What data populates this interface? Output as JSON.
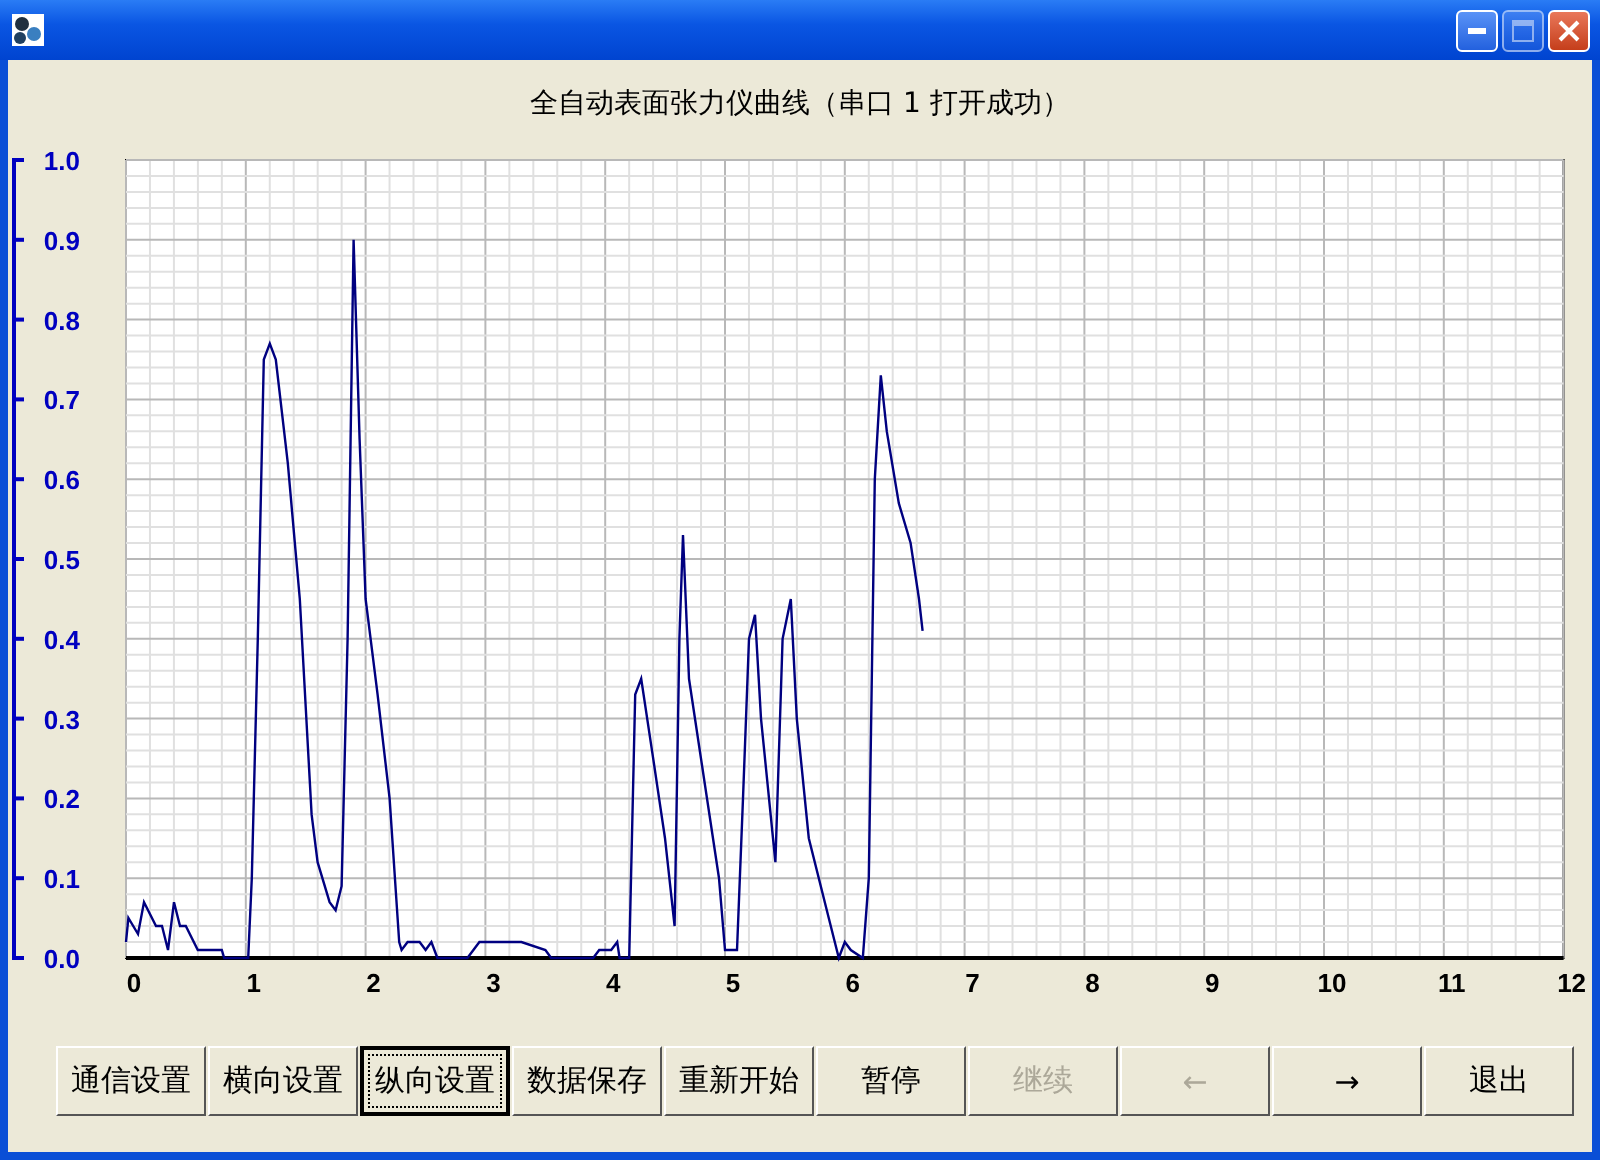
{
  "window": {
    "controls": [
      {
        "kind": "minimize",
        "disabled": false
      },
      {
        "kind": "maximize",
        "disabled": true
      },
      {
        "kind": "close",
        "disabled": false
      }
    ]
  },
  "chart": {
    "title": "全自动表面张力仪曲线（串口 1 打开成功）",
    "chart_data": {
      "type": "line",
      "grid": true,
      "xlim": [
        0,
        12
      ],
      "ylim": [
        0,
        1
      ],
      "xticks": [
        0,
        1,
        2,
        3,
        4,
        5,
        6,
        7,
        8,
        9,
        10,
        11,
        12
      ],
      "yticks": [
        {
          "value": 0,
          "label": "0.0"
        },
        {
          "value": 0.1,
          "label": "0.1"
        },
        {
          "value": 0.2,
          "label": "0.2"
        },
        {
          "value": 0.3,
          "label": "0.3"
        },
        {
          "value": 0.4,
          "label": "0.4"
        },
        {
          "value": 0.5,
          "label": "0.5"
        },
        {
          "value": 0.6,
          "label": "0.6"
        },
        {
          "value": 0.7,
          "label": "0.7"
        },
        {
          "value": 0.8,
          "label": "0.8"
        },
        {
          "value": 0.9,
          "label": "0.9"
        },
        {
          "value": 1,
          "label": "1.0"
        }
      ],
      "x": [
        0,
        0.02,
        0.1,
        0.15,
        0.25,
        0.3,
        0.35,
        0.4,
        0.45,
        0.5,
        0.6,
        0.8,
        0.82,
        1.02,
        1.05,
        1.1,
        1.15,
        1.2,
        1.25,
        1.35,
        1.45,
        1.55,
        1.6,
        1.7,
        1.75,
        1.8,
        1.85,
        1.9,
        1.95,
        2.0,
        2.1,
        2.2,
        2.28,
        2.3,
        2.35,
        2.45,
        2.5,
        2.55,
        2.6,
        2.85,
        2.95,
        3.3,
        3.5,
        3.55,
        3.9,
        3.95,
        4.05,
        4.1,
        4.12,
        4.2,
        4.25,
        4.3,
        4.4,
        4.5,
        4.58,
        4.62,
        4.65,
        4.7,
        4.8,
        4.95,
        5.0,
        5.1,
        5.15,
        5.2,
        5.25,
        5.3,
        5.42,
        5.48,
        5.55,
        5.6,
        5.7,
        5.85,
        5.95,
        6.0,
        6.05,
        6.15,
        6.2,
        6.25,
        6.3,
        6.35,
        6.45,
        6.55,
        6.62,
        6.65
      ],
      "series": [
        {
          "color": "#000080",
          "values": [
            0.02,
            0.05,
            0.03,
            0.07,
            0.04,
            0.04,
            0.01,
            0.07,
            0.04,
            0.04,
            0.01,
            0.01,
            0,
            0,
            0.1,
            0.4,
            0.75,
            0.77,
            0.75,
            0.62,
            0.45,
            0.18,
            0.12,
            0.07,
            0.06,
            0.09,
            0.4,
            0.9,
            0.65,
            0.45,
            0.33,
            0.2,
            0.02,
            0.01,
            0.02,
            0.02,
            0.01,
            0.02,
            0,
            0,
            0.02,
            0.02,
            0.01,
            0,
            0,
            0.01,
            0.01,
            0.02,
            0,
            0,
            0.33,
            0.35,
            0.25,
            0.15,
            0.04,
            0.4,
            0.53,
            0.35,
            0.25,
            0.1,
            0.01,
            0.01,
            0.2,
            0.4,
            0.43,
            0.3,
            0.12,
            0.4,
            0.45,
            0.3,
            0.15,
            0.06,
            0,
            0.02,
            0.01,
            0,
            0.1,
            0.6,
            0.73,
            0.66,
            0.57,
            0.52,
            0.45,
            0.41
          ]
        }
      ]
    }
  },
  "buttons": [
    {
      "label": "通信设置",
      "focused": false,
      "disabled": false
    },
    {
      "label": "横向设置",
      "focused": false,
      "disabled": false
    },
    {
      "label": "纵向设置",
      "focused": true,
      "disabled": false
    },
    {
      "label": "数据保存",
      "focused": false,
      "disabled": false
    },
    {
      "label": "重新开始",
      "focused": false,
      "disabled": false
    },
    {
      "label": "暂停",
      "focused": false,
      "disabled": false
    },
    {
      "label": "继续",
      "focused": false,
      "disabled": true
    },
    {
      "label": "←",
      "focused": false,
      "disabled": true
    },
    {
      "label": "→",
      "focused": false,
      "disabled": false
    },
    {
      "label": "退出",
      "focused": false,
      "disabled": false
    }
  ]
}
